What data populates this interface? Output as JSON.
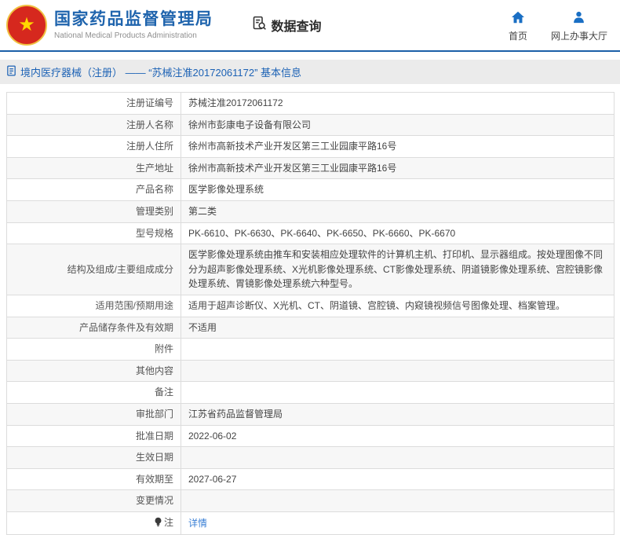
{
  "header": {
    "org_title": "国家药品监督管理局",
    "org_subtitle": "National Medical Products Administration",
    "section_label": "数据查询",
    "nav_home": "首页",
    "nav_hall": "网上办事大厅"
  },
  "breadcrumb": {
    "text": "境内医疗器械（注册） —— “苏械注准20172061172” 基本信息"
  },
  "table": {
    "rows": [
      {
        "label": "注册证编号",
        "value": "苏械注准20172061172"
      },
      {
        "label": "注册人名称",
        "value": "徐州市彭康电子设备有限公司"
      },
      {
        "label": "注册人住所",
        "value": "徐州市高新技术产业开发区第三工业园康平路16号"
      },
      {
        "label": "生产地址",
        "value": "徐州市高新技术产业开发区第三工业园康平路16号"
      },
      {
        "label": "产品名称",
        "value": "医学影像处理系统"
      },
      {
        "label": "管理类别",
        "value": "第二类"
      },
      {
        "label": "型号规格",
        "value": "PK-6610、PK-6630、PK-6640、PK-6650、PK-6660、PK-6670"
      },
      {
        "label": "结构及组成/主要组成成分",
        "value": "医学影像处理系统由推车和安装相应处理软件的计算机主机、打印机、显示器组成。按处理图像不同分为超声影像处理系统、X光机影像处理系统、CT影像处理系统、阴道镜影像处理系统、宫腔镜影像处理系统、胃镜影像处理系统六种型号。"
      },
      {
        "label": "适用范围/预期用途",
        "value": "适用于超声诊断仪、X光机、CT、阴道镜、宫腔镜、内窥镜视频信号图像处理、档案管理。"
      },
      {
        "label": "产品储存条件及有效期",
        "value": "不适用"
      },
      {
        "label": "附件",
        "value": ""
      },
      {
        "label": "其他内容",
        "value": ""
      },
      {
        "label": "备注",
        "value": ""
      },
      {
        "label": "审批部门",
        "value": "江苏省药品监督管理局"
      },
      {
        "label": "批准日期",
        "value": "2022-06-02"
      },
      {
        "label": "生效日期",
        "value": ""
      },
      {
        "label": "有效期至",
        "value": "2027-06-27"
      },
      {
        "label": "变更情况",
        "value": ""
      },
      {
        "label": "注",
        "value": "详情",
        "link": true,
        "icon": "bulb-icon"
      }
    ]
  },
  "colors": {
    "brand_blue": "#1f64ad",
    "divider_blue": "#1c5fa8",
    "breadcrumb_blue": "#1c62b5",
    "link_blue": "#3a7fd5",
    "emblem_red": "#d6281e",
    "emblem_gold": "#f0c040",
    "breadcrumb_bg": "#ebebeb",
    "alt_row_bg": "#f7f7f7"
  }
}
